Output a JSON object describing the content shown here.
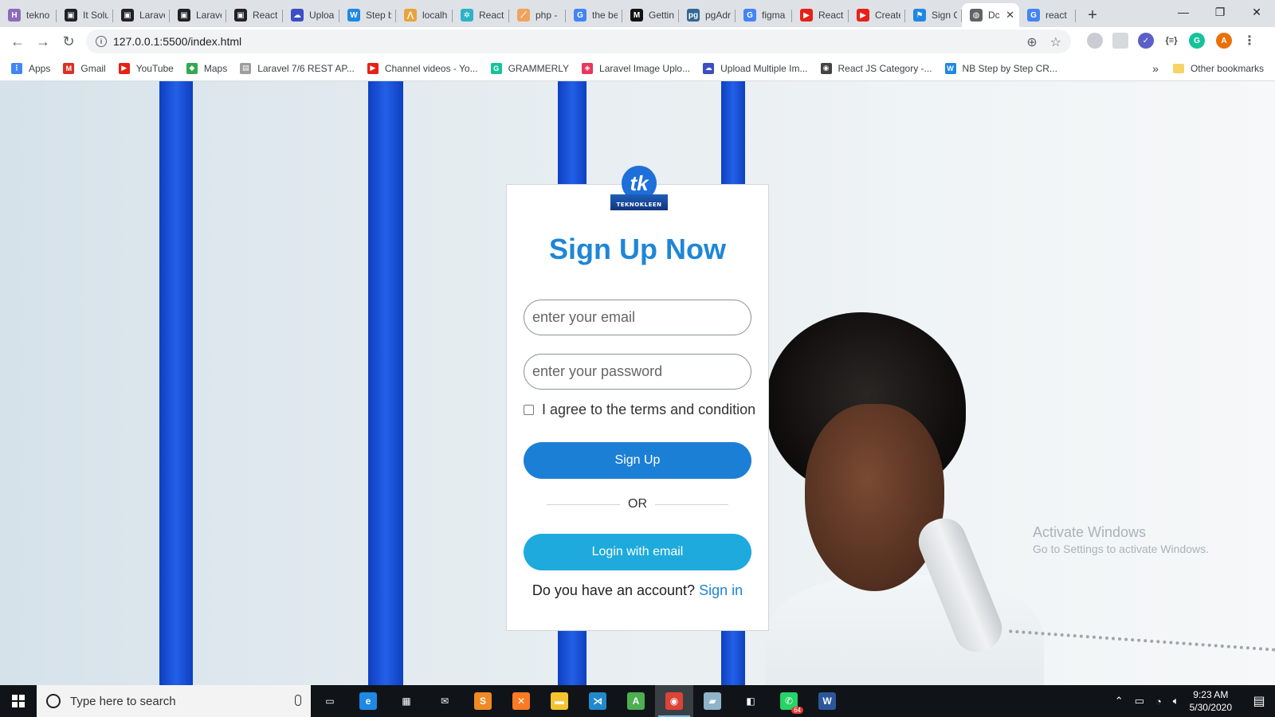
{
  "browser": {
    "tabs": [
      {
        "title": "tekno",
        "icon": "h-icon",
        "color": "#8c6bb8",
        "glyph": "H"
      },
      {
        "title": "It Solu",
        "icon": "site-icon",
        "color": "#202124",
        "glyph": "▣"
      },
      {
        "title": "Larave",
        "icon": "site-icon",
        "color": "#202124",
        "glyph": "▣"
      },
      {
        "title": "Larave",
        "icon": "site-icon",
        "color": "#202124",
        "glyph": "▣"
      },
      {
        "title": "React",
        "icon": "site-icon",
        "color": "#202124",
        "glyph": "▣"
      },
      {
        "title": "Uploa",
        "icon": "cloud-icon",
        "color": "#3b4fc4",
        "glyph": "☁"
      },
      {
        "title": "Step b",
        "icon": "w-icon",
        "color": "#1e88e5",
        "glyph": "W"
      },
      {
        "title": "localh",
        "icon": "xampp-icon",
        "color": "#e8a33b",
        "glyph": "⋀"
      },
      {
        "title": "React",
        "icon": "react-icon",
        "color": "#2bb3c8",
        "glyph": "✲"
      },
      {
        "title": "php -",
        "icon": "php-icon",
        "color": "#f0a35e",
        "glyph": "⟋"
      },
      {
        "title": "the be",
        "icon": "google-icon",
        "color": "#4285f4",
        "glyph": "G"
      },
      {
        "title": "Gettin",
        "icon": "medium-icon",
        "color": "#111111",
        "glyph": "M"
      },
      {
        "title": "pgAdr",
        "icon": "pgadmin-icon",
        "color": "#336791",
        "glyph": "pg"
      },
      {
        "title": "figma",
        "icon": "google-icon",
        "color": "#4285f4",
        "glyph": "G"
      },
      {
        "title": "React",
        "icon": "youtube-icon",
        "color": "#e62117",
        "glyph": "▶"
      },
      {
        "title": "Create",
        "icon": "youtube-icon",
        "color": "#e62117",
        "glyph": "▶"
      },
      {
        "title": "Sign C",
        "icon": "flag-icon",
        "color": "#1e88e5",
        "glyph": "⚑"
      },
      {
        "title": "Dc",
        "icon": "globe-icon",
        "color": "#5f6368",
        "glyph": "◍",
        "active": true
      },
      {
        "title": "react",
        "icon": "google-icon",
        "color": "#4285f4",
        "glyph": "G"
      }
    ],
    "new_tab": "+",
    "url": "127.0.0.1:5500/index.html",
    "profile_initial": "A",
    "bookmarks": [
      {
        "label": "Apps",
        "icon": "apps-grid-icon",
        "color": "#4285f4",
        "glyph": "⋮"
      },
      {
        "label": "Gmail",
        "icon": "gmail-icon",
        "color": "#d93025",
        "glyph": "M"
      },
      {
        "label": "YouTube",
        "icon": "youtube-icon",
        "color": "#e62117",
        "glyph": "▶"
      },
      {
        "label": "Maps",
        "icon": "maps-icon",
        "color": "#34a853",
        "glyph": "◆"
      },
      {
        "label": "Laravel 7/6 REST AP...",
        "icon": "site-icon",
        "color": "#9e9e9e",
        "glyph": "▤"
      },
      {
        "label": "Channel videos - Yo...",
        "icon": "youtube-icon",
        "color": "#e62117",
        "glyph": "▶"
      },
      {
        "label": "GRAMMERLY",
        "icon": "grammarly-icon",
        "color": "#15c39a",
        "glyph": "G"
      },
      {
        "label": "Laravel Image Uplo...",
        "icon": "site-icon",
        "color": "#e8365d",
        "glyph": "◈"
      },
      {
        "label": "Upload Multiple Im...",
        "icon": "cloud-icon",
        "color": "#3b4fc4",
        "glyph": "☁"
      },
      {
        "label": "React JS Category -...",
        "icon": "site-icon",
        "color": "#444444",
        "glyph": "◉"
      },
      {
        "label": "NB Step by Step CR...",
        "icon": "w-icon",
        "color": "#1e88e5",
        "glyph": "W"
      }
    ],
    "bookmarks_more": "»",
    "other_bookmarks": "Other bookmarks"
  },
  "form": {
    "logo_text": "tk",
    "logo_brand": "TEKNOKLEEN",
    "title": "Sign Up Now",
    "email_placeholder": "enter your email",
    "password_placeholder": "enter your password",
    "terms_label": "I agree to the terms and condition",
    "signup_button": "Sign Up",
    "or_text": "OR",
    "login_button": "Login with email",
    "account_question": "Do you have an account?",
    "signin_link": "Sign in"
  },
  "watermark": {
    "line1": "Activate Windows",
    "line2": "Go to Settings to activate Windows."
  },
  "taskbar": {
    "search_placeholder": "Type here to search",
    "apps": [
      {
        "name": "task-view-icon",
        "color": "#101418",
        "glyph": "▭"
      },
      {
        "name": "edge-icon",
        "color": "#1e88e5",
        "glyph": "e"
      },
      {
        "name": "store-icon",
        "color": "#101418",
        "glyph": "▦"
      },
      {
        "name": "mail-icon",
        "color": "#101418",
        "glyph": "✉"
      },
      {
        "name": "sublime-icon",
        "color": "#f08a24",
        "glyph": "S"
      },
      {
        "name": "xampp-icon",
        "color": "#fb7a24",
        "glyph": "✕"
      },
      {
        "name": "folder-icon",
        "color": "#f4c430",
        "glyph": "▬"
      },
      {
        "name": "vscode-icon",
        "color": "#2489ca",
        "glyph": "⋊"
      },
      {
        "name": "app-icon",
        "color": "#4caf50",
        "glyph": "A"
      },
      {
        "name": "chrome-icon",
        "color": "#db4437",
        "glyph": "◉",
        "active": true
      },
      {
        "name": "app-icon",
        "color": "#8fb3c9",
        "glyph": "▰"
      },
      {
        "name": "sticky-icon",
        "color": "#101418",
        "glyph": "◧"
      },
      {
        "name": "whatsapp-icon",
        "color": "#25d366",
        "glyph": "✆",
        "badge": "64"
      },
      {
        "name": "word-icon",
        "color": "#2b579a",
        "glyph": "W"
      }
    ],
    "time": "9:23 AM",
    "date": "5/30/2020",
    "notification_count": "1"
  }
}
